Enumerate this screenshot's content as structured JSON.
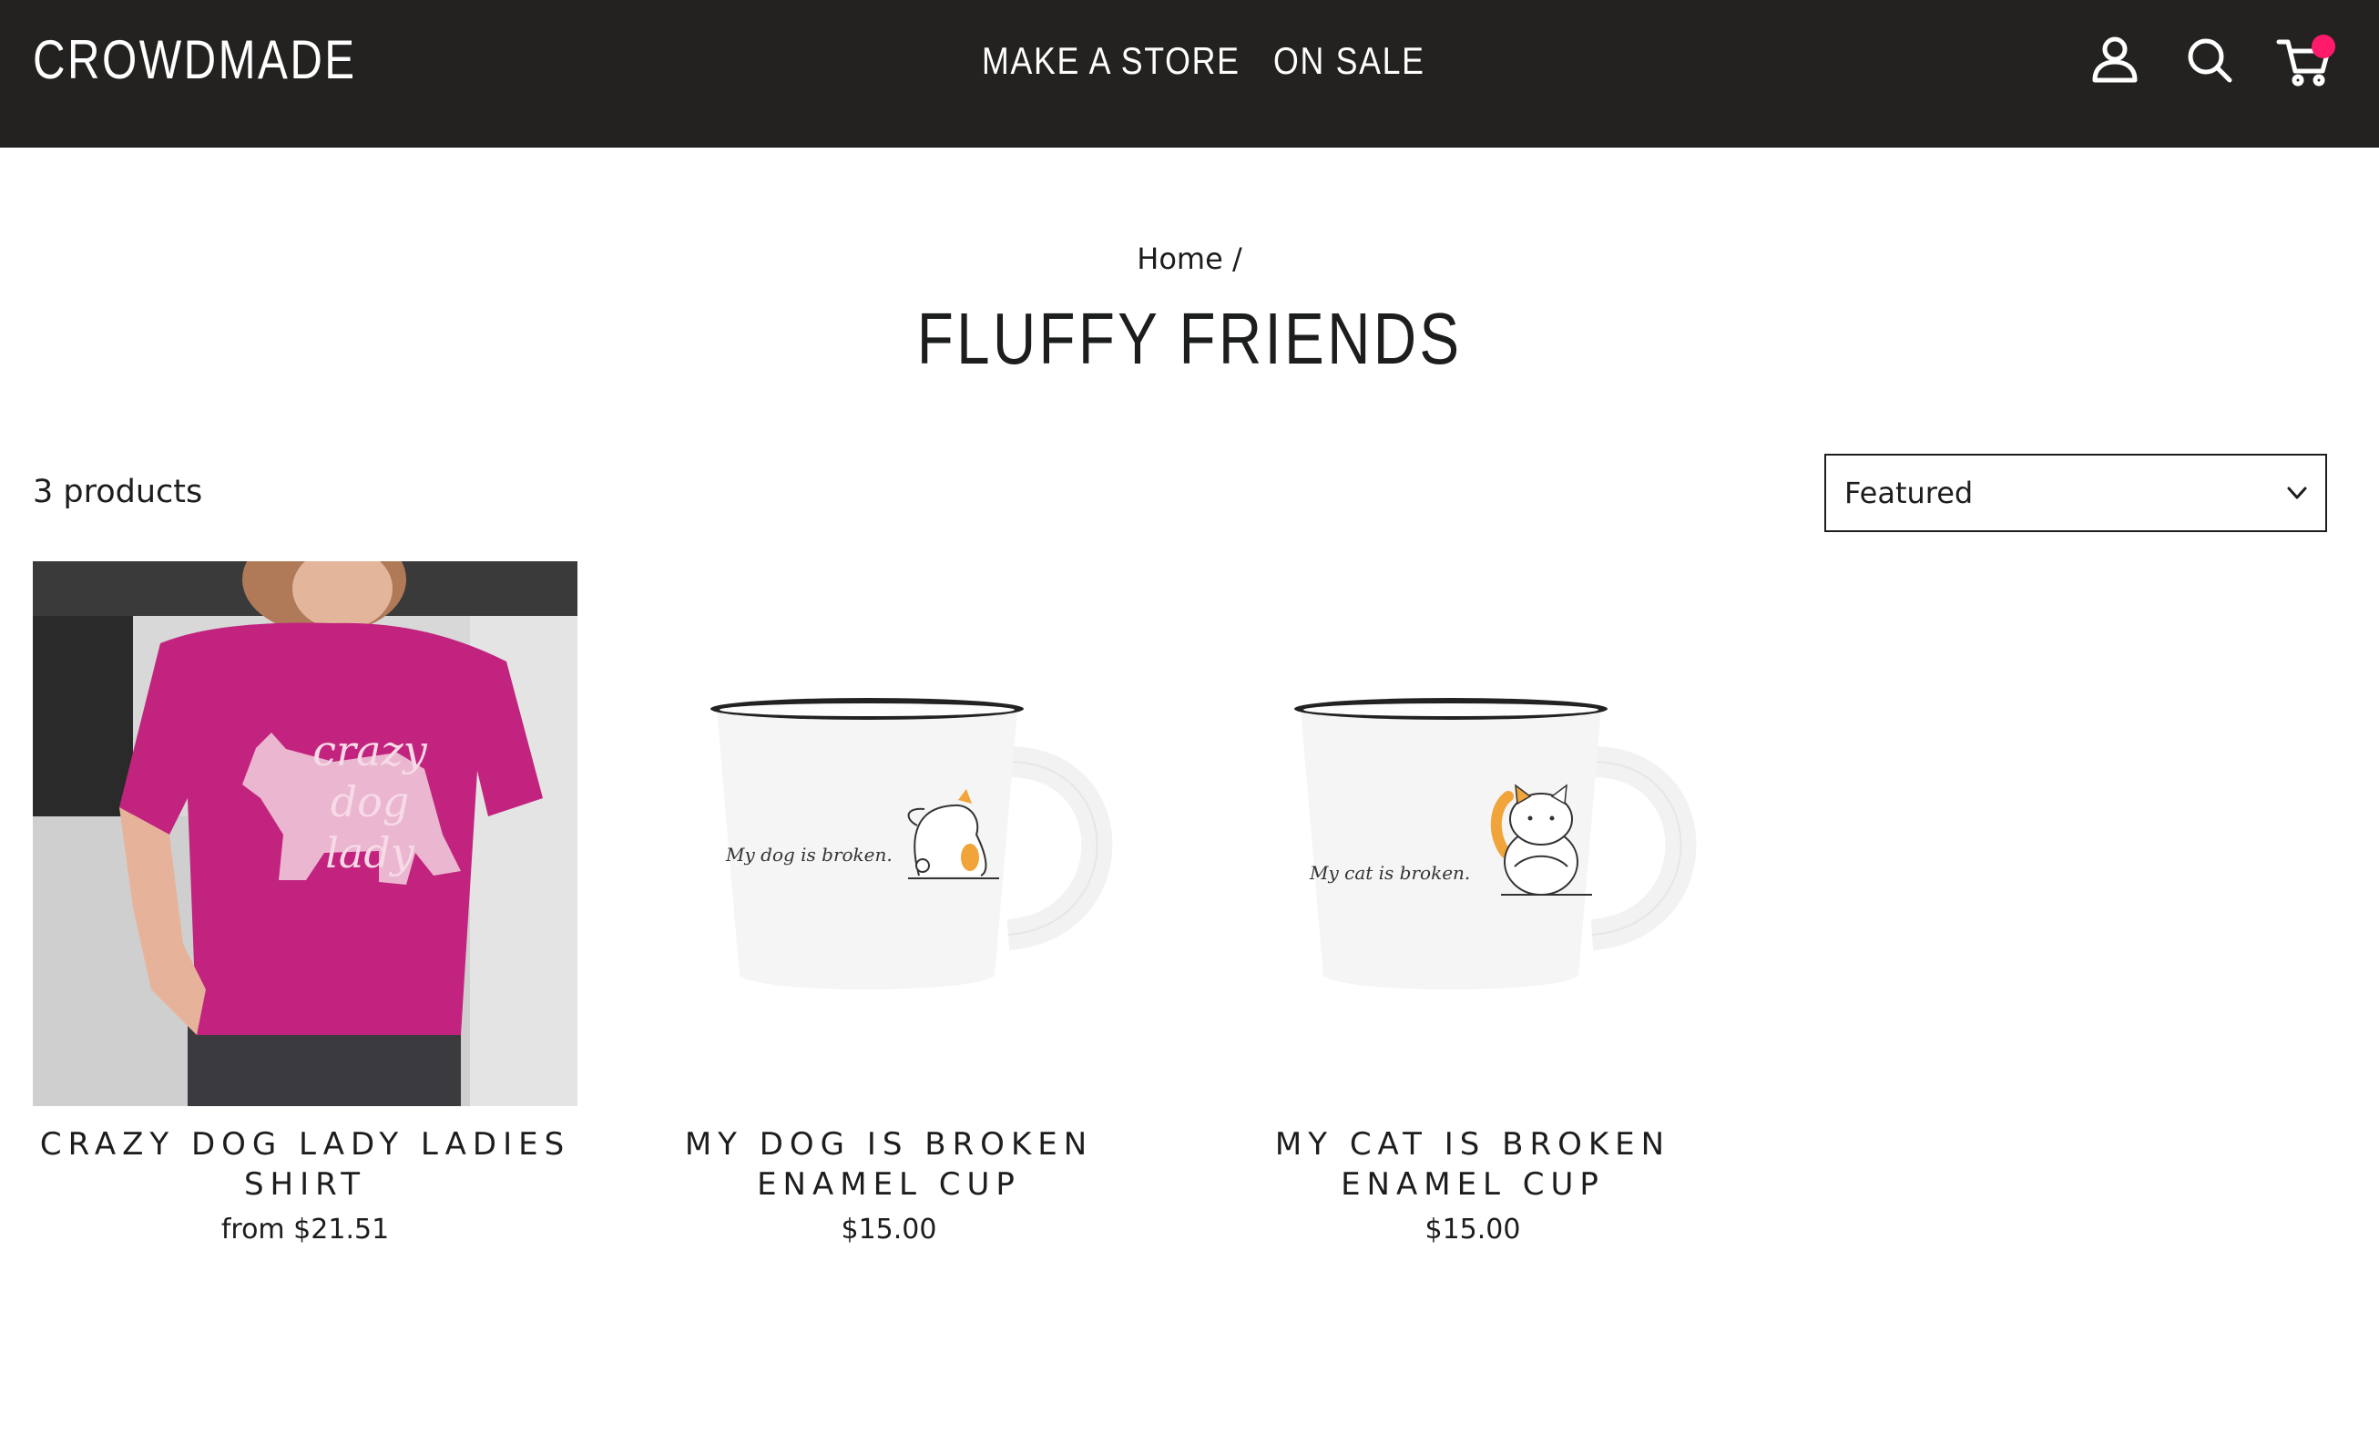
{
  "header": {
    "logo": "CROWDMADE",
    "nav": [
      {
        "label": "MAKE A STORE"
      },
      {
        "label": "ON SALE"
      }
    ],
    "icons": [
      "account-icon",
      "search-icon",
      "cart-icon"
    ],
    "cart_badge_color": "#ff1a6b",
    "background": "#232220"
  },
  "breadcrumb": {
    "home": "Home",
    "separator": "/"
  },
  "collection": {
    "title": "FLUFFY FRIENDS",
    "count_label": "3 products",
    "sort": {
      "selected": "Featured"
    }
  },
  "products": [
    {
      "title": "CRAZY DOG LADY LADIES SHIRT",
      "price": "from $21.51",
      "shirt_text": [
        "crazy",
        "dog",
        "lady"
      ],
      "shirt_color": "#c2237e"
    },
    {
      "title": "MY DOG IS BROKEN ENAMEL CUP",
      "price": "$15.00",
      "mug_text": "My dog is broken."
    },
    {
      "title": "MY CAT IS BROKEN ENAMEL CUP",
      "price": "$15.00",
      "mug_text": "My cat is broken."
    }
  ]
}
